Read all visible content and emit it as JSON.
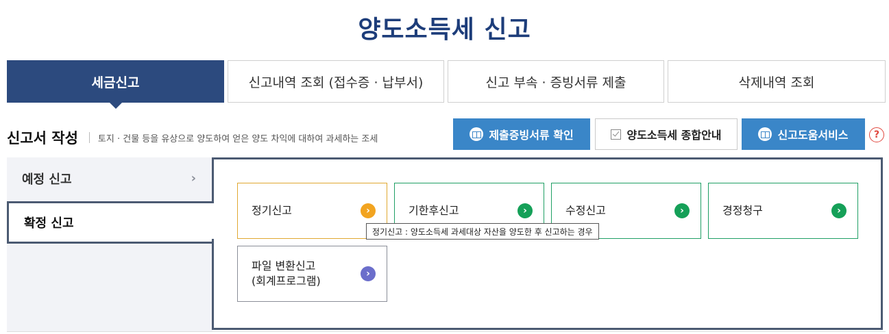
{
  "page": {
    "title": "양도소득세  신고"
  },
  "tabs": [
    {
      "label": "세금신고",
      "active": true
    },
    {
      "label": "신고내역 조회 (접수증 · 납부서)"
    },
    {
      "label": "신고 부속 · 증빙서류 제출"
    },
    {
      "label": "삭제내역 조회"
    }
  ],
  "section": {
    "title": "신고서 작성",
    "description": "토지 · 건물 등을 유상으로 양도하여 얻은 양도 차익에 대하여 과세하는 조세"
  },
  "actions": {
    "evidence": "제출증빙서류 확인",
    "guide": "양도소득세 종합안내",
    "help_service": "신고도움서비스",
    "help_icon": "?"
  },
  "side_menu": [
    {
      "label": "예정 신고",
      "chevron": "›"
    },
    {
      "label": "확정 신고",
      "active": true
    }
  ],
  "cards": [
    {
      "label": "정기신고",
      "arrow": "›"
    },
    {
      "label": "기한후신고",
      "arrow": "›"
    },
    {
      "label": "수정신고",
      "arrow": "›"
    },
    {
      "label": "경정청구",
      "arrow": "›"
    },
    {
      "label_line1": "파일 변환신고",
      "label_line2": "(회계프로그램)",
      "arrow": "›"
    }
  ],
  "tooltip": "정기신고 : 양도소득세 과세대상 자산을 양도한 후 신고하는 경우",
  "colors": {
    "title": "#1d3d7a",
    "active_tab": "#2c4a7e",
    "action_blue": "#3a86c8",
    "panel_border": "#4b5a72",
    "orange": "#f2a420",
    "green": "#15a058",
    "purple": "#6b6ecb",
    "help_red": "#e0473e"
  },
  "icons": {
    "evidence": "book-icon",
    "guide": "checkbox-icon",
    "help_service": "book-icon",
    "help": "question-icon",
    "chevron": "chevron-right-icon",
    "card_arrow": "arrow-circle-right-icon"
  }
}
